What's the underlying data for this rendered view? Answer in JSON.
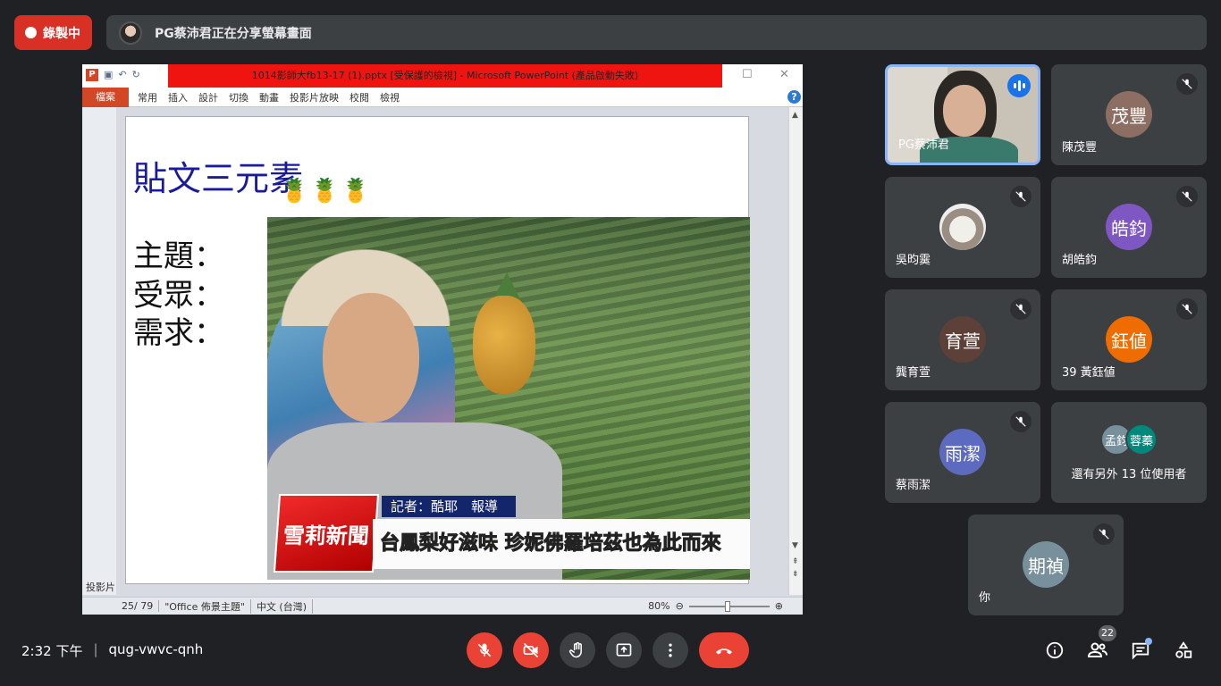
{
  "recording": {
    "label": "錄製中"
  },
  "share_banner": {
    "text": "PG蔡沛君正在分享螢幕畫面"
  },
  "powerpoint": {
    "title": "1014影師大fb13-17 (1).pptx [受保護的檢視] - Microsoft PowerPoint (產品啟動失敗)",
    "file_tab": "檔案",
    "tabs": [
      "常用",
      "插入",
      "設計",
      "切換",
      "動畫",
      "投影片放映",
      "校閱",
      "檢視"
    ],
    "left_panel_label": "投影片",
    "status": {
      "slide": "25/ 79",
      "theme": "\"Office 佈景主題\"",
      "language": "中文 (台灣)",
      "zoom": "80%"
    },
    "slide": {
      "title": "貼文三元素",
      "bullets": [
        "主題：",
        "受眾：",
        "需求："
      ],
      "reporter": "記者：酷耶　報導",
      "news_logo": "雪莉新聞",
      "headline": "台鳳梨好滋味 珍妮佛羅培茲也為此而來"
    }
  },
  "participants": [
    {
      "name": "PG蔡沛君",
      "type": "video",
      "speaking": true
    },
    {
      "name": "陳茂豐",
      "initials": "茂豐",
      "color": "#8d6e63",
      "muted": true
    },
    {
      "name": "吳昀霙",
      "type": "photo",
      "muted": true
    },
    {
      "name": "胡皓鈞",
      "initials": "皓鈞",
      "color": "#7e57c2",
      "muted": true
    },
    {
      "name": "龔育萱",
      "initials": "育萱",
      "color": "#5d4037",
      "muted": true
    },
    {
      "name": "39 黃鈺値",
      "initials": "鈺値",
      "color": "#ef6c00",
      "muted": true
    },
    {
      "name": "蔡雨潔",
      "initials": "雨潔",
      "color": "#5c6bc0",
      "muted": true
    },
    {
      "others_label": "還有另外 13 位使用者",
      "initials": [
        "孟鈞",
        "蓉蓁"
      ],
      "colors": [
        "#78909c",
        "#00897b"
      ]
    },
    {
      "name": "你",
      "initials": "期禎",
      "color": "#78909c",
      "muted": true
    }
  ],
  "bottom_bar": {
    "time": "2:32 下午",
    "meeting_code": "qug-vwvc-qnh",
    "participant_count": "22"
  },
  "icons": {
    "mic_off": "mic-off-icon",
    "camera_off": "camera-off-icon",
    "hand": "raise-hand-icon",
    "present": "present-icon",
    "more": "more-vert-icon",
    "end_call": "call-end-icon",
    "info": "info-icon",
    "people": "people-icon",
    "chat": "chat-icon",
    "activities": "activities-icon"
  },
  "colors": {
    "accent": "#8ab4f8",
    "danger": "#ea4335",
    "surface": "#3c4043",
    "background": "#202124"
  }
}
